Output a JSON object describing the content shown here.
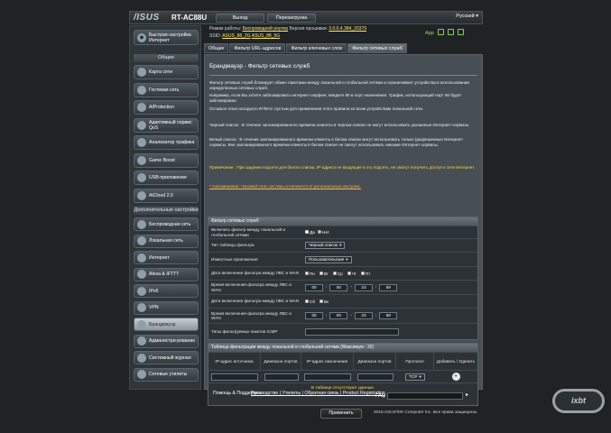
{
  "header": {
    "brand": "/ISUS",
    "model": "RT-AC88U",
    "logout": "Выход",
    "reboot": "Перезагрузка",
    "language": "Русский"
  },
  "status": {
    "mode_label": "Режим работы:",
    "mode_value": "Беспроводной роутер",
    "fw_label": "Версия прошивки:",
    "fw_value": "3.0.0.4.384_20379",
    "ssid_label": "SSID:",
    "ssid_1": "ASUS_88_2G",
    "ssid_2": "ASUS_88_5G",
    "app": "App"
  },
  "sidebar": {
    "quick_setup": "Быстрая настройка Интернет",
    "general_header": "Общие",
    "general": [
      {
        "label": "Карта сети",
        "icon": "network-map-icon"
      },
      {
        "label": "Гостевая сеть",
        "icon": "guest-network-icon"
      },
      {
        "label": "AiProtection",
        "icon": "aiprotection-icon"
      },
      {
        "label": "Адаптивный сервис QoS",
        "icon": "qos-icon"
      },
      {
        "label": "Анализатор трафика",
        "icon": "traffic-analyzer-icon"
      },
      {
        "label": "Game Boost",
        "icon": "game-boost-icon"
      },
      {
        "label": "USB-приложение",
        "icon": "usb-app-icon"
      },
      {
        "label": "AiCloud 2.0",
        "icon": "aicloud-icon"
      }
    ],
    "advanced_header": "Дополнительные настройки",
    "advanced": [
      {
        "label": "Беспроводная сеть",
        "icon": "wireless-icon"
      },
      {
        "label": "Локальная сеть",
        "icon": "lan-icon"
      },
      {
        "label": "Интернет",
        "icon": "wan-icon"
      },
      {
        "label": "Alexa & IFTTT",
        "icon": "alexa-icon"
      },
      {
        "label": "IPv6",
        "icon": "ipv6-icon"
      },
      {
        "label": "VPN",
        "icon": "vpn-icon"
      },
      {
        "label": "Брандмауэр",
        "icon": "firewall-icon"
      },
      {
        "label": "Администри-рование",
        "icon": "administration-icon"
      },
      {
        "label": "Системный журнал",
        "icon": "system-log-icon"
      },
      {
        "label": "Сетевые утилиты",
        "icon": "network-tools-icon"
      }
    ]
  },
  "tabs": [
    "Общие",
    "Фильтр URL-адресов",
    "Фильтр ключевых слов",
    "Фильтр сетевых служб"
  ],
  "page": {
    "title": "Брандмауэр - Фильтр сетевых служб",
    "p1": "Фильтр сетевых служб блокирует обмен пакетами между локальной и глобальной сетями и ограничивает устройства в использовании определенных сетевых служб.",
    "p2": "Например, если Вы хотите заблокировать интернет-серфинг, введите 80 в порт назначения. Трафик, использующий порт 80 будет заблокирован.",
    "p3": "Оставьте поле исходного IP/MAC пустым для применения этого правила ко всем устройствам локальной сети.",
    "p4": "Черный список : В течение запланированного времени клиенты в черном списке не могут использовать указанные Интернет-сервисы.",
    "p5": "Белый список : В течение запланированного времени клиенты в белом списке могут использовать только (разрешенные Интернет-сервисы. Вне запланированного времени клиенты в белом списке не смогут использовать никакие Интернет-сервисы.",
    "note": "Примечание : При задании подсети для белого списка, IP-адреса не входящие в эту подсеть, не смогут получить доступ к сети Интернет.",
    "reminder": "* Напоминание: Часовой пояс системы отличается от региональных настроек."
  },
  "filter_table": {
    "title": "Фильтр сетевых служб",
    "rows": [
      {
        "label": "Включить фильтр между локальной и глобальной сетями",
        "yes": "Да",
        "no": "Нет"
      },
      {
        "label": "Тип таблицы фильтра",
        "value": "Черный список"
      },
      {
        "label": "Известные приложения",
        "value": "Пользовательские"
      },
      {
        "label": "Дата включения фильтра между ЛВС и WAN",
        "days": [
          "Пн",
          "Вт",
          "Ср",
          "Чт",
          "Пт"
        ]
      },
      {
        "label": "Время включения фильтра между ЛВС и WAN",
        "times": [
          "00",
          "00",
          "23",
          "59"
        ]
      },
      {
        "label": "Дата включения фильтра между ЛВС и WAN",
        "days": [
          "Сб",
          "Вс"
        ]
      },
      {
        "label": "Время включения фильтра между ЛВС и WAN",
        "times": [
          "00",
          "00",
          "23",
          "59"
        ]
      },
      {
        "label": "Типы фильтруемых пакетов ICMP"
      }
    ]
  },
  "rules_table": {
    "title": "Таблица фильтрации между локальной и глобальной сетями (Максимум : 32)",
    "columns": [
      "IP-адрес источника",
      "Диапазон портов",
      "IP-адрес назначения",
      "Диапазон портов",
      "Протокол",
      "Добавить / Удалить"
    ],
    "protocol": "TCP",
    "empty": "В таблице отсутствуют данные.",
    "apply": "Применить"
  },
  "footer": {
    "help": "Помощь & Поддержка",
    "links": "Руководство | Утилиты | Обратная связь | Product Registration",
    "faq": "FAQ",
    "copyright": "2018 ASUSTeK Computer Inc. Все права защищены."
  },
  "colors": {
    "background": "#1f2326",
    "panel": "#474f54",
    "accent_yellow": "#ffd84a",
    "status_green": "#8de35a"
  }
}
